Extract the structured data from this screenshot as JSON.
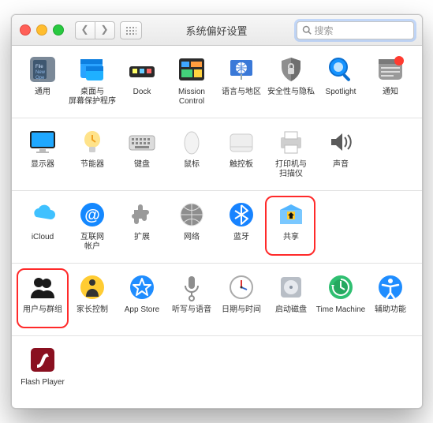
{
  "window": {
    "title": "系统偏好设置",
    "search_placeholder": "搜索"
  },
  "rows": [
    [
      {
        "id": "general",
        "label": "通用"
      },
      {
        "id": "desktop",
        "label": "桌面与\n屏幕保护程序"
      },
      {
        "id": "dock",
        "label": "Dock"
      },
      {
        "id": "mission-control",
        "label": "Mission\nControl"
      },
      {
        "id": "language-region",
        "label": "语言与地区"
      },
      {
        "id": "security-privacy",
        "label": "安全性与隐私"
      },
      {
        "id": "spotlight",
        "label": "Spotlight"
      },
      {
        "id": "notifications",
        "label": "通知"
      }
    ],
    [
      {
        "id": "displays",
        "label": "显示器"
      },
      {
        "id": "energy",
        "label": "节能器"
      },
      {
        "id": "keyboard",
        "label": "键盘"
      },
      {
        "id": "mouse",
        "label": "鼠标"
      },
      {
        "id": "trackpad",
        "label": "触控板"
      },
      {
        "id": "printers",
        "label": "打印机与\n扫描仪"
      },
      {
        "id": "sound",
        "label": "声音"
      }
    ],
    [
      {
        "id": "icloud",
        "label": "iCloud"
      },
      {
        "id": "internet-accounts",
        "label": "互联网\n帐户"
      },
      {
        "id": "extensions",
        "label": "扩展"
      },
      {
        "id": "network",
        "label": "网络"
      },
      {
        "id": "bluetooth",
        "label": "蓝牙"
      },
      {
        "id": "sharing",
        "label": "共享",
        "highlight": true
      }
    ],
    [
      {
        "id": "users-groups",
        "label": "用户与群组",
        "highlight": true
      },
      {
        "id": "parental-controls",
        "label": "家长控制"
      },
      {
        "id": "app-store",
        "label": "App Store"
      },
      {
        "id": "dictation-speech",
        "label": "听写与语音"
      },
      {
        "id": "date-time",
        "label": "日期与时间"
      },
      {
        "id": "startup-disk",
        "label": "启动磁盘"
      },
      {
        "id": "time-machine",
        "label": "Time Machine"
      },
      {
        "id": "accessibility",
        "label": "辅助功能"
      }
    ],
    [
      {
        "id": "flash-player",
        "label": "Flash Player"
      }
    ]
  ]
}
